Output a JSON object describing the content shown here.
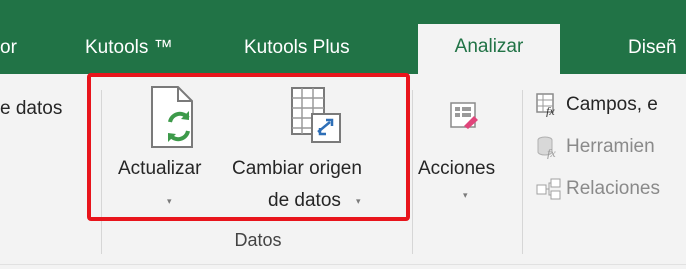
{
  "tabs": [
    {
      "label": "or"
    },
    {
      "label": "Kutools ™"
    },
    {
      "label": "Kutools Plus"
    },
    {
      "label": "Analizar"
    },
    {
      "label": "Diseñ"
    }
  ],
  "ribbon": {
    "partial_left_label": "e datos",
    "refresh": {
      "label": "Actualizar",
      "caret": "▾",
      "icon": "refresh-icon"
    },
    "change_source": {
      "label_line1": "Cambiar origen",
      "label_line2": "de datos",
      "caret": "▾",
      "icon": "change-data-source-icon"
    },
    "actions": {
      "label": "Acciones",
      "caret": "▾",
      "icon": "actions-icon"
    },
    "group_label": "Datos",
    "right_items": [
      {
        "label": "Campos, e",
        "icon": "fx-fields-icon"
      },
      {
        "label": "Herramien",
        "icon": "fx-tools-icon"
      },
      {
        "label": "Relaciones",
        "icon": "relationships-icon"
      }
    ]
  },
  "colors": {
    "tab_bar": "#217346",
    "highlight_border": "#e8141b",
    "refresh_green": "#3d9a4a"
  }
}
